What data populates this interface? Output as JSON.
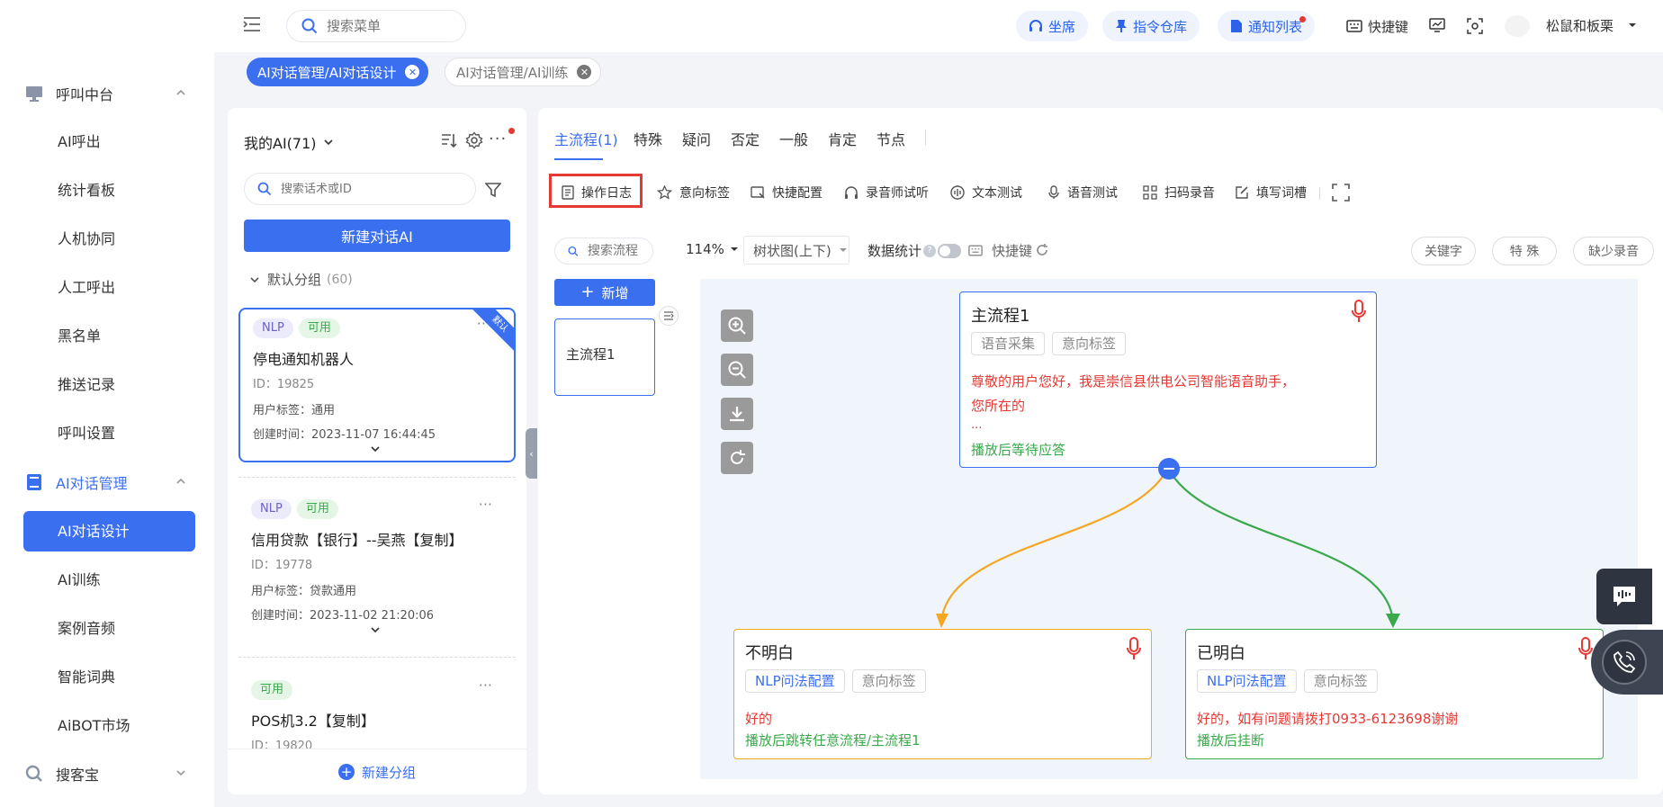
{
  "topbar": {
    "search_placeholder": "搜索菜单",
    "pills": [
      "坐席",
      "指令仓库",
      "通知列表"
    ],
    "shortcut_label": "快捷键",
    "user_name": "松鼠和板栗"
  },
  "sidebar": {
    "group1": "呼叫中台",
    "group1_items": [
      "AI呼出",
      "统计看板",
      "人机协同",
      "人工呼出",
      "黑名单",
      "推送记录",
      "呼叫设置"
    ],
    "group2": "AI对话管理",
    "group2_items": [
      "AI对话设计",
      "AI训练",
      "案例音频",
      "智能词典",
      "AiBOT市场"
    ],
    "group3": "搜客宝"
  },
  "route_tabs": [
    "AI对话管理/AI对话设计",
    "AI对话管理/AI训练"
  ],
  "left_panel": {
    "title": "我的AI(71)",
    "search_placeholder": "搜索话术或ID",
    "new_button": "新建对话AI",
    "group_name": "默认分组",
    "group_count": "(60)",
    "corner_badge": "默认",
    "new_group": "新建分组",
    "cards": [
      {
        "tags": [
          "NLP",
          "可用"
        ],
        "title": "停电通知机器人",
        "id": "ID：19825",
        "user_tag": "用户标签：通用",
        "created": "创建时间：2023-11-07 16:44:45"
      },
      {
        "tags": [
          "NLP",
          "可用"
        ],
        "title": "信用贷款【银行】--吴燕【复制】",
        "id": "ID：19778",
        "user_tag": "用户标签：贷款通用",
        "created": "创建时间：2023-11-02 21:20:06"
      },
      {
        "tags": [
          "可用"
        ],
        "title": "POS机3.2【复制】",
        "id": "ID：19820"
      }
    ]
  },
  "main": {
    "flow_tabs": [
      "主流程(1)",
      "特殊",
      "疑问",
      "否定",
      "一般",
      "肯定",
      "节点"
    ],
    "tools": [
      "操作日志",
      "意向标签",
      "快捷配置",
      "录音师试听",
      "文本测试",
      "语音测试",
      "扫码录音",
      "填写词槽"
    ],
    "flow_search_placeholder": "搜索流程",
    "add_flow": "新增",
    "flow_list": [
      "主流程1"
    ],
    "zoom": "114%",
    "view_mode": "树状图(上下)",
    "stats_label": "数据统计",
    "shortcut": "快捷键",
    "right_buttons": [
      "关键字",
      "特 殊",
      "缺少录音"
    ],
    "nodes": {
      "root": {
        "title": "主流程1",
        "chips": [
          "语音采集",
          "意向标签"
        ],
        "text1": "尊敬的用户您好，我是崇信县供电公司智能语音助手，",
        "text2": "您所在的",
        "text3": "...",
        "action": "播放后等待应答"
      },
      "left": {
        "title": "不明白",
        "chips": [
          "NLP问法配置",
          "意向标签"
        ],
        "text": "好的",
        "action": "播放后跳转任意流程/主流程1"
      },
      "right": {
        "title": "已明白",
        "chips": [
          "NLP问法配置",
          "意向标签"
        ],
        "text": "好的，如有问题请拨打0933-6123698谢谢",
        "action": "播放后挂断"
      }
    }
  },
  "colors": {
    "primary": "#3a6ff0",
    "red": "#e53935",
    "green": "#3aa94b",
    "orange": "#f5a623"
  }
}
